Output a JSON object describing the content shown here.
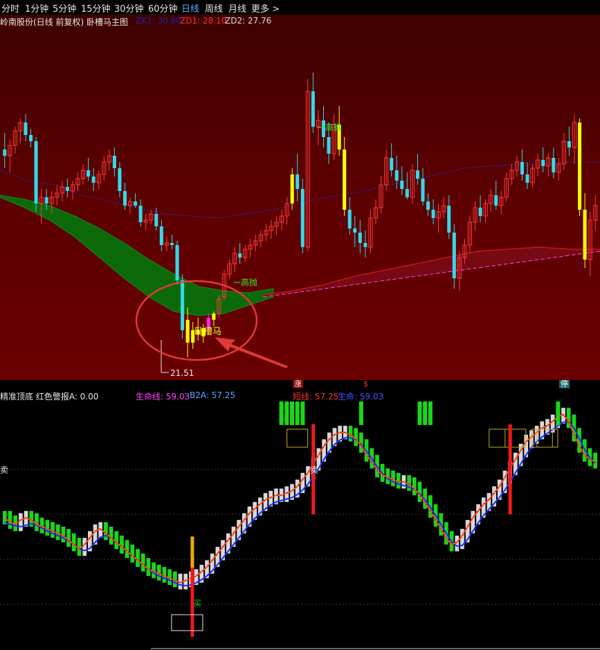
{
  "tabs": [
    "分时",
    "1分钟",
    "5分钟",
    "15分钟",
    "30分钟",
    "60分钟",
    "日线",
    "周线",
    "月线",
    "更多 >"
  ],
  "active_tab": "日线",
  "main_panel": {
    "title": "岭南股份(日线 前复权) 卧槽马主图",
    "indicators": [
      {
        "label": "ZK1: 30.90",
        "color": "#2222aa"
      },
      {
        "label": "ZD1: 28.10",
        "color": "#ff3333"
      },
      {
        "label": "ZD2: 27.76",
        "color": "#dddddd"
      }
    ],
    "annotations": {
      "high_throw_1": "高抛",
      "high_throw_2": "高抛",
      "pattern": "卧槽马",
      "low_price": "21.51"
    }
  },
  "separator_badges": [
    "涨",
    "$",
    "停"
  ],
  "sub_panel": {
    "title": "精准顶底 红色警报A: 0.00",
    "life_line": "生命线: 59.03",
    "b2a": "B2A: 57.25",
    "short_line": "短线: 57.25",
    "life": "生命: 59.03",
    "sell_1": "卖",
    "sell_2": "卖",
    "buy": "买"
  },
  "colors": {
    "up": "#ff3b3b",
    "down": "#35d8e8",
    "yellow": "#ffff00",
    "magenta": "#ff22ff",
    "green_band": "#0a6a0a",
    "bg_main": "#5a0000",
    "bar_white": "#d8d8d8",
    "bar_green": "#18d818"
  },
  "chart_data": {
    "type": "candlestick",
    "price_low_label": 21.51,
    "ohlc": [
      [
        31.5,
        32.3,
        30.6,
        31.2
      ],
      [
        31.2,
        32.0,
        30.4,
        31.7
      ],
      [
        31.7,
        32.6,
        31.3,
        32.4
      ],
      [
        32.4,
        33.0,
        31.8,
        32.8
      ],
      [
        32.8,
        33.2,
        31.9,
        32.2
      ],
      [
        32.2,
        32.5,
        31.6,
        31.9
      ],
      [
        31.9,
        32.1,
        28.5,
        28.9
      ],
      [
        28.9,
        29.6,
        27.9,
        29.2
      ],
      [
        29.2,
        29.6,
        28.6,
        28.9
      ],
      [
        28.9,
        29.5,
        28.4,
        29.2
      ],
      [
        29.2,
        29.8,
        28.8,
        29.4
      ],
      [
        29.4,
        30.0,
        29.0,
        29.7
      ],
      [
        29.7,
        30.1,
        29.2,
        29.5
      ],
      [
        29.5,
        30.0,
        29.1,
        29.8
      ],
      [
        29.8,
        30.4,
        29.5,
        30.1
      ],
      [
        30.1,
        30.8,
        29.8,
        30.5
      ],
      [
        30.5,
        31.1,
        30.0,
        30.2
      ],
      [
        30.2,
        30.6,
        29.5,
        29.9
      ],
      [
        29.9,
        30.5,
        29.6,
        30.3
      ],
      [
        30.3,
        31.2,
        30.0,
        30.9
      ],
      [
        30.9,
        31.5,
        30.5,
        31.2
      ],
      [
        31.2,
        31.6,
        30.2,
        30.6
      ],
      [
        30.6,
        30.9,
        29.2,
        29.5
      ],
      [
        29.5,
        29.9,
        28.6,
        28.8
      ],
      [
        28.8,
        29.2,
        28.4,
        29.0
      ],
      [
        29.0,
        29.4,
        28.7,
        28.8
      ],
      [
        28.8,
        29.1,
        27.8,
        28.0
      ],
      [
        28.0,
        28.4,
        27.6,
        28.1
      ],
      [
        28.1,
        28.6,
        27.9,
        28.4
      ],
      [
        28.4,
        28.7,
        27.6,
        27.8
      ],
      [
        27.8,
        28.1,
        26.6,
        26.9
      ],
      [
        26.9,
        27.3,
        26.6,
        27.0
      ],
      [
        27.0,
        27.4,
        26.7,
        26.9
      ],
      [
        26.9,
        27.1,
        25.0,
        25.2
      ],
      [
        25.2,
        25.5,
        22.4,
        22.8
      ],
      [
        23.3,
        23.9,
        21.5,
        22.2
      ],
      [
        22.2,
        23.2,
        21.9,
        22.8
      ],
      [
        22.8,
        23.4,
        22.3,
        22.6
      ],
      [
        22.5,
        23.1,
        22.2,
        22.9
      ],
      [
        22.9,
        23.6,
        22.6,
        23.4
      ],
      [
        23.3,
        23.7,
        23.0,
        23.6
      ],
      [
        23.6,
        24.5,
        23.4,
        24.3
      ],
      [
        24.4,
        25.7,
        24.2,
        25.5
      ],
      [
        25.5,
        26.2,
        25.3,
        26.0
      ],
      [
        26.0,
        26.8,
        25.6,
        26.5
      ],
      [
        26.5,
        27.0,
        26.0,
        26.3
      ],
      [
        26.3,
        26.9,
        26.1,
        26.7
      ],
      [
        26.7,
        27.2,
        26.3,
        26.9
      ],
      [
        26.9,
        27.4,
        26.6,
        27.1
      ],
      [
        27.1,
        27.6,
        26.8,
        27.4
      ],
      [
        27.4,
        27.9,
        27.1,
        27.6
      ],
      [
        27.6,
        28.1,
        27.2,
        27.8
      ],
      [
        27.8,
        28.3,
        27.4,
        28.0
      ],
      [
        28.0,
        28.6,
        27.6,
        28.3
      ],
      [
        28.3,
        29.2,
        27.9,
        28.9
      ],
      [
        28.9,
        30.6,
        28.6,
        30.3
      ],
      [
        30.3,
        31.3,
        29.0,
        29.6
      ],
      [
        29.6,
        30.1,
        26.5,
        26.8
      ],
      [
        26.8,
        34.9,
        26.6,
        34.3
      ],
      [
        34.3,
        35.2,
        32.3,
        32.6
      ],
      [
        32.6,
        33.4,
        31.7,
        32.9
      ],
      [
        32.9,
        33.6,
        31.6,
        32.1
      ],
      [
        32.1,
        32.8,
        30.8,
        31.3
      ],
      [
        31.3,
        33.2,
        31.0,
        32.7
      ],
      [
        32.7,
        33.6,
        31.2,
        31.5
      ],
      [
        31.5,
        32.1,
        28.3,
        28.6
      ],
      [
        28.6,
        29.2,
        27.4,
        27.7
      ],
      [
        27.7,
        28.3,
        26.8,
        27.5
      ],
      [
        27.5,
        28.1,
        26.5,
        27.0
      ],
      [
        27.0,
        27.6,
        26.3,
        26.8
      ],
      [
        26.8,
        28.6,
        26.5,
        28.2
      ],
      [
        28.2,
        29.1,
        27.9,
        28.7
      ],
      [
        28.7,
        30.2,
        28.4,
        29.8
      ],
      [
        29.8,
        31.5,
        29.5,
        31.1
      ],
      [
        31.1,
        31.8,
        30.2,
        30.5
      ],
      [
        30.5,
        31.2,
        29.6,
        30.0
      ],
      [
        30.0,
        30.7,
        29.3,
        29.6
      ],
      [
        29.6,
        30.4,
        29.1,
        29.2
      ],
      [
        29.2,
        30.8,
        28.9,
        30.5
      ],
      [
        30.5,
        31.3,
        29.8,
        30.1
      ],
      [
        30.1,
        30.6,
        28.8,
        29.0
      ],
      [
        29.0,
        29.4,
        28.3,
        28.6
      ],
      [
        28.6,
        29.1,
        27.9,
        28.2
      ],
      [
        28.2,
        28.9,
        27.5,
        28.5
      ],
      [
        28.5,
        29.2,
        28.2,
        28.8
      ],
      [
        28.8,
        29.3,
        27.2,
        27.5
      ],
      [
        27.5,
        27.9,
        24.8,
        25.3
      ],
      [
        25.3,
        26.6,
        24.7,
        26.3
      ],
      [
        26.3,
        27.2,
        26.0,
        26.9
      ],
      [
        26.9,
        28.3,
        26.5,
        28.0
      ],
      [
        28.0,
        29.0,
        27.6,
        28.7
      ],
      [
        28.7,
        29.3,
        28.0,
        28.3
      ],
      [
        28.3,
        29.1,
        28.0,
        28.9
      ],
      [
        28.9,
        29.6,
        28.5,
        29.3
      ],
      [
        29.3,
        30.0,
        28.6,
        28.8
      ],
      [
        28.8,
        29.5,
        28.4,
        29.2
      ],
      [
        29.2,
        30.4,
        29.0,
        30.1
      ],
      [
        30.1,
        30.8,
        29.8,
        30.5
      ],
      [
        30.5,
        31.2,
        30.2,
        30.9
      ],
      [
        30.9,
        31.5,
        30.0,
        30.3
      ],
      [
        30.3,
        30.9,
        29.6,
        29.9
      ],
      [
        29.9,
        30.8,
        29.7,
        30.6
      ],
      [
        30.6,
        31.3,
        30.2,
        31.0
      ],
      [
        31.0,
        31.6,
        30.4,
        30.7
      ],
      [
        30.7,
        31.3,
        30.2,
        31.1
      ],
      [
        31.1,
        31.6,
        30.1,
        30.4
      ],
      [
        30.4,
        31.1,
        30.0,
        30.8
      ],
      [
        30.8,
        32.3,
        30.5,
        31.9
      ],
      [
        31.9,
        32.6,
        31.2,
        31.6
      ],
      [
        31.6,
        33.2,
        30.8,
        32.8
      ],
      [
        32.8,
        33.0,
        28.3,
        28.6
      ],
      [
        28.6,
        29.4,
        25.8,
        26.2
      ],
      [
        26.2,
        28.5,
        25.4,
        28.1
      ],
      [
        28.1,
        29.3,
        27.6,
        28.8
      ]
    ],
    "highlight_yellow_index": [
      35,
      36,
      37,
      38,
      40,
      55,
      64,
      65,
      110,
      111
    ],
    "highlight_magenta_index": [
      39
    ],
    "ma_dashed": [
      30.5,
      30.0,
      29.8,
      29.3,
      29.0,
      28.7,
      28.4,
      28.3,
      28.2,
      28.4,
      28.6,
      28.9,
      29.2,
      29.4,
      29.7,
      30.0,
      30.3,
      30.6,
      30.7,
      30.8,
      30.8,
      30.9,
      30.9
    ],
    "band_upper": [
      29.3,
      29.1,
      28.8,
      28.3,
      27.7,
      27.0,
      26.2,
      25.5,
      24.9,
      24.7,
      24.6,
      24.8
    ],
    "band_lower": [
      29.2,
      28.7,
      28.1,
      27.3,
      26.3,
      25.3,
      24.4,
      23.7,
      23.5,
      23.6,
      24.0,
      24.4
    ],
    "ma_red": [
      24.5,
      24.7,
      25.0,
      25.4,
      25.7,
      26.0,
      26.3,
      26.6,
      26.7,
      26.8,
      26.7,
      26.7
    ],
    "ma_pink": [
      24.4,
      24.6,
      24.8,
      25.0,
      25.2,
      25.4,
      25.6,
      25.8,
      26.0,
      26.2,
      26.4,
      26.6
    ],
    "sub_bars": [
      [
        52,
        "g"
      ],
      [
        50,
        "g"
      ],
      [
        49,
        "g"
      ],
      [
        51,
        "w"
      ],
      [
        52,
        "w"
      ],
      [
        51,
        "g"
      ],
      [
        49,
        "g"
      ],
      [
        48,
        "g"
      ],
      [
        47,
        "g"
      ],
      [
        46,
        "g"
      ],
      [
        45,
        "g"
      ],
      [
        44,
        "g"
      ],
      [
        42,
        "g"
      ],
      [
        40,
        "g"
      ],
      [
        38,
        "g"
      ],
      [
        40,
        "w"
      ],
      [
        43,
        "w"
      ],
      [
        46,
        "w"
      ],
      [
        47,
        "w"
      ],
      [
        45,
        "g"
      ],
      [
        43,
        "g"
      ],
      [
        41,
        "g"
      ],
      [
        39,
        "g"
      ],
      [
        37,
        "g"
      ],
      [
        35,
        "g"
      ],
      [
        33,
        "g"
      ],
      [
        31,
        "g"
      ],
      [
        29,
        "g"
      ],
      [
        28,
        "g"
      ],
      [
        27,
        "g"
      ],
      [
        26,
        "g"
      ],
      [
        25,
        "g"
      ],
      [
        24,
        "g"
      ],
      [
        23,
        "w"
      ],
      [
        24,
        "w"
      ],
      [
        25,
        "w"
      ],
      [
        26,
        "w"
      ],
      [
        28,
        "w"
      ],
      [
        30,
        "w"
      ],
      [
        33,
        "w"
      ],
      [
        36,
        "w"
      ],
      [
        39,
        "w"
      ],
      [
        42,
        "w"
      ],
      [
        45,
        "w"
      ],
      [
        48,
        "w"
      ],
      [
        51,
        "w"
      ],
      [
        54,
        "w"
      ],
      [
        56,
        "w"
      ],
      [
        58,
        "w"
      ],
      [
        60,
        "w"
      ],
      [
        61,
        "w"
      ],
      [
        62,
        "w"
      ],
      [
        62,
        "w"
      ],
      [
        63,
        "w"
      ],
      [
        64,
        "w"
      ],
      [
        66,
        "w"
      ],
      [
        69,
        "w"
      ],
      [
        72,
        "w"
      ],
      [
        76,
        "w"
      ],
      [
        80,
        "w"
      ],
      [
        84,
        "w"
      ],
      [
        87,
        "w"
      ],
      [
        89,
        "w"
      ],
      [
        90,
        "w"
      ],
      [
        90,
        "w"
      ],
      [
        89,
        "g"
      ],
      [
        87,
        "g"
      ],
      [
        84,
        "g"
      ],
      [
        80,
        "g"
      ],
      [
        77,
        "g"
      ],
      [
        73,
        "g"
      ],
      [
        71,
        "g"
      ],
      [
        70,
        "g"
      ],
      [
        69,
        "g"
      ],
      [
        68,
        "g"
      ],
      [
        68,
        "w"
      ],
      [
        67,
        "g"
      ],
      [
        65,
        "g"
      ],
      [
        62,
        "g"
      ],
      [
        59,
        "g"
      ],
      [
        55,
        "g"
      ],
      [
        51,
        "g"
      ],
      [
        47,
        "g"
      ],
      [
        43,
        "g"
      ],
      [
        40,
        "g"
      ],
      [
        41,
        "w"
      ],
      [
        44,
        "w"
      ],
      [
        48,
        "w"
      ],
      [
        52,
        "w"
      ],
      [
        55,
        "w"
      ],
      [
        58,
        "w"
      ],
      [
        60,
        "w"
      ],
      [
        63,
        "w"
      ],
      [
        66,
        "w"
      ],
      [
        70,
        "w"
      ],
      [
        74,
        "w"
      ],
      [
        78,
        "w"
      ],
      [
        82,
        "w"
      ],
      [
        86,
        "w"
      ],
      [
        88,
        "w"
      ],
      [
        90,
        "w"
      ],
      [
        92,
        "w"
      ],
      [
        93,
        "w"
      ],
      [
        95,
        "w"
      ],
      [
        97,
        "w"
      ],
      [
        98,
        "w"
      ],
      [
        95,
        "g"
      ],
      [
        89,
        "g"
      ],
      [
        84,
        "g"
      ],
      [
        80,
        "g"
      ],
      [
        78,
        "g"
      ],
      [
        77,
        "g"
      ]
    ],
    "green_top_bar_index": [
      52,
      53,
      54,
      55,
      56,
      67,
      78,
      79,
      80,
      104
    ],
    "yellow_box_index": [
      55,
      93,
      96,
      101,
      102
    ],
    "sub_red_vertical_index": [
      58,
      95
    ],
    "buy_index": 35
  }
}
